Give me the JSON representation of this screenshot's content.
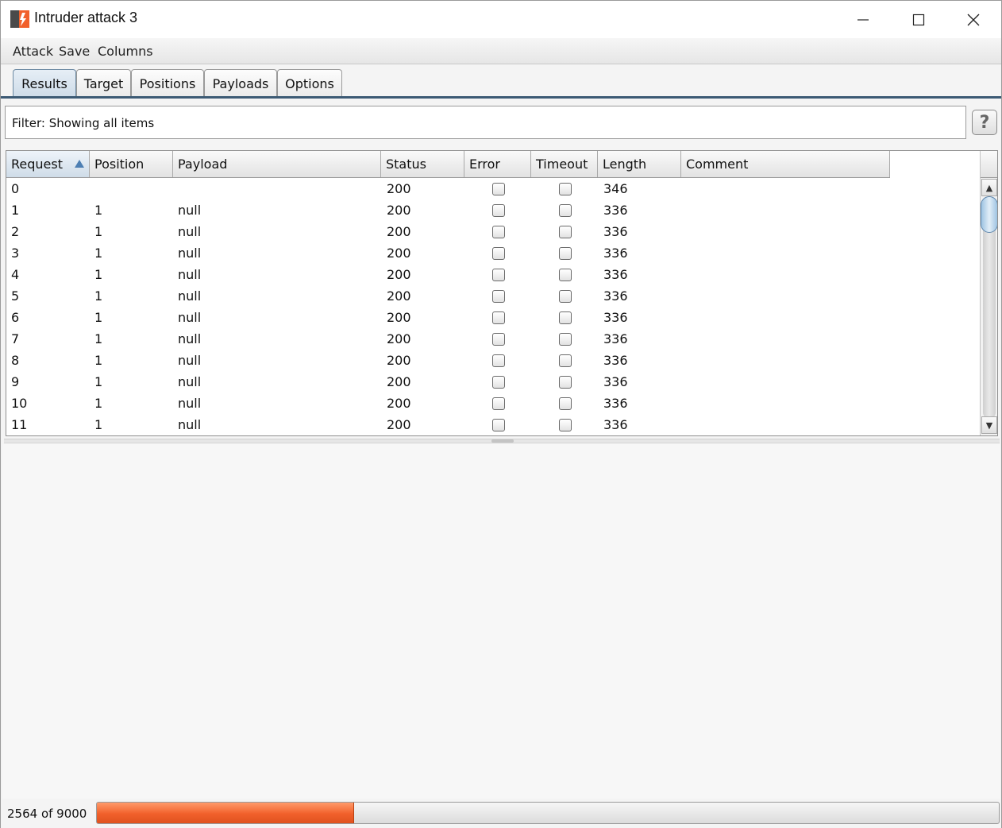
{
  "window": {
    "title": "Intruder attack 3",
    "accent_color": "#f1602b"
  },
  "menu": [
    "Attack",
    "Save",
    "Columns"
  ],
  "tabs": [
    {
      "label": "Results",
      "active": true
    },
    {
      "label": "Target",
      "active": false
    },
    {
      "label": "Positions",
      "active": false
    },
    {
      "label": "Payloads",
      "active": false
    },
    {
      "label": "Options",
      "active": false
    }
  ],
  "filter": {
    "text": "Filter:  Showing all items",
    "help_label": "?"
  },
  "table": {
    "columns": [
      "Request",
      "Position",
      "Payload",
      "Status",
      "Error",
      "Timeout",
      "Length",
      "Comment"
    ],
    "sorted_column": "Request",
    "rows": [
      {
        "request": "0",
        "position": "",
        "payload": "",
        "status": "200",
        "error": false,
        "timeout": false,
        "length": "346",
        "comment": ""
      },
      {
        "request": "1",
        "position": "1",
        "payload": "null",
        "status": "200",
        "error": false,
        "timeout": false,
        "length": "336",
        "comment": ""
      },
      {
        "request": "2",
        "position": "1",
        "payload": "null",
        "status": "200",
        "error": false,
        "timeout": false,
        "length": "336",
        "comment": ""
      },
      {
        "request": "3",
        "position": "1",
        "payload": "null",
        "status": "200",
        "error": false,
        "timeout": false,
        "length": "336",
        "comment": ""
      },
      {
        "request": "4",
        "position": "1",
        "payload": "null",
        "status": "200",
        "error": false,
        "timeout": false,
        "length": "336",
        "comment": ""
      },
      {
        "request": "5",
        "position": "1",
        "payload": "null",
        "status": "200",
        "error": false,
        "timeout": false,
        "length": "336",
        "comment": ""
      },
      {
        "request": "6",
        "position": "1",
        "payload": "null",
        "status": "200",
        "error": false,
        "timeout": false,
        "length": "336",
        "comment": ""
      },
      {
        "request": "7",
        "position": "1",
        "payload": "null",
        "status": "200",
        "error": false,
        "timeout": false,
        "length": "336",
        "comment": ""
      },
      {
        "request": "8",
        "position": "1",
        "payload": "null",
        "status": "200",
        "error": false,
        "timeout": false,
        "length": "336",
        "comment": ""
      },
      {
        "request": "9",
        "position": "1",
        "payload": "null",
        "status": "200",
        "error": false,
        "timeout": false,
        "length": "336",
        "comment": ""
      },
      {
        "request": "10",
        "position": "1",
        "payload": "null",
        "status": "200",
        "error": false,
        "timeout": false,
        "length": "336",
        "comment": ""
      },
      {
        "request": "11",
        "position": "1",
        "payload": "null",
        "status": "200",
        "error": false,
        "timeout": false,
        "length": "336",
        "comment": ""
      }
    ]
  },
  "progress": {
    "text": "2564 of 9000",
    "completed": 2564,
    "total": 9000
  }
}
